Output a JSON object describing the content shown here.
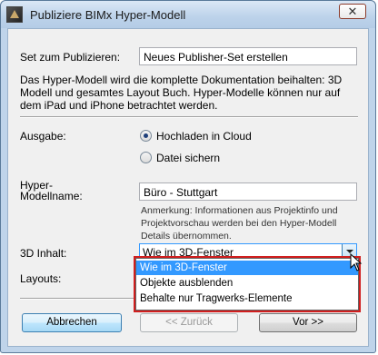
{
  "window": {
    "title": "Publiziere BIMx Hyper-Modell",
    "close_glyph": "✕"
  },
  "publish_set": {
    "label": "Set zum Publizieren:",
    "value": "Neues Publisher-Set erstellen"
  },
  "info_text": "Das Hyper-Modell wird die komplette Dokumentation beihalten: 3D Modell und gesamtes Layout Buch. Hyper-Modelle können nur auf dem iPad und iPhone betrachtet werden.",
  "output": {
    "label": "Ausgabe:",
    "options": [
      {
        "label": "Hochladen in Cloud",
        "checked": true
      },
      {
        "label": "Datei sichern",
        "checked": false
      }
    ]
  },
  "model_name": {
    "label_line1": "Hyper-",
    "label_line2": "Modellname:",
    "value": "Büro - Stuttgart",
    "note": "Anmerkung: Informationen aus Projektinfo und Projektvorschau werden bei den Hyper-Modell Details übernommen."
  },
  "content_3d": {
    "label": "3D Inhalt:",
    "value": "Wie im 3D-Fenster",
    "options": [
      "Wie im 3D-Fenster",
      "Objekte ausblenden",
      "Behalte nur Tragwerks-Elemente"
    ],
    "selected_index": 0
  },
  "layouts": {
    "label": "Layouts:"
  },
  "buttons": {
    "cancel": "Abbrechen",
    "back": "<< Zurück",
    "next": "Vor >>"
  },
  "colors": {
    "highlight": "#d11e1e",
    "selection": "#3399ff"
  }
}
